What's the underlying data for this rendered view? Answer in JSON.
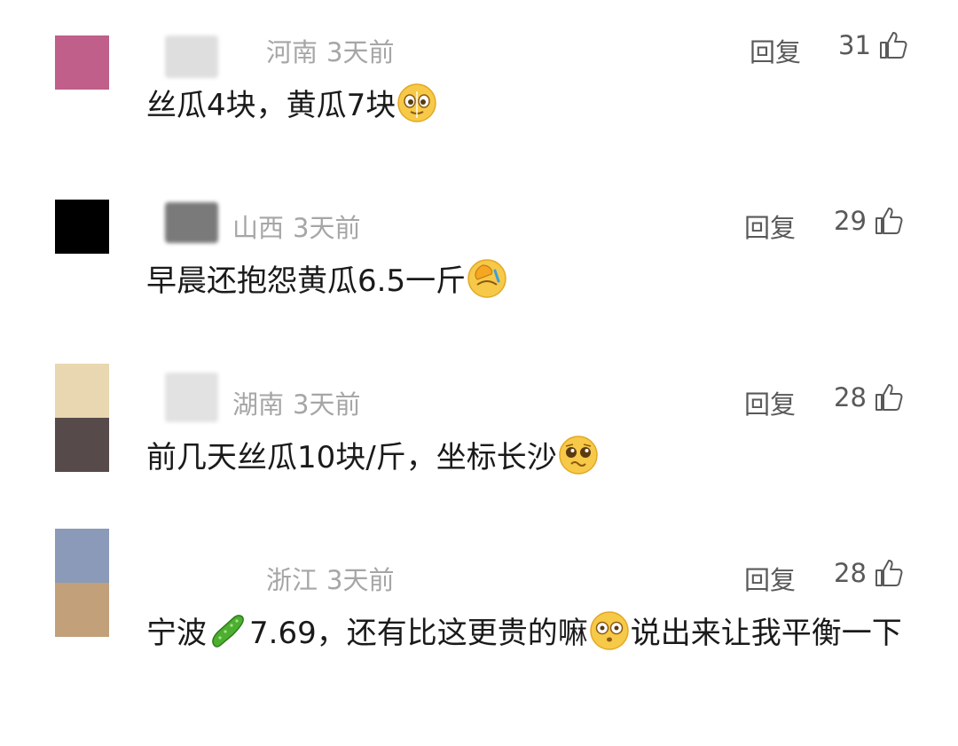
{
  "comments": [
    {
      "avatar_colors": [
        "#bf5f8a"
      ],
      "location": "河南",
      "time": "3天前",
      "reply_label": "回复",
      "likes": "31",
      "text_before": "丝瓜4块，黄瓜7块",
      "emoji": "smile-with-tear-emoji",
      "text_after": ""
    },
    {
      "avatar_colors": [
        "#000000"
      ],
      "location": "山西",
      "time": "3天前",
      "reply_label": "回复",
      "likes": "29",
      "text_before": "早晨还抱怨黄瓜6.5一斤",
      "emoji": "facepalm-emoji",
      "text_after": ""
    },
    {
      "avatar_colors": [
        "#e8d7b0",
        "#574a4a"
      ],
      "location": "湖南",
      "time": "3天前",
      "reply_label": "回复",
      "likes": "28",
      "text_before": "前几天丝瓜10块/斤，坐标长沙",
      "emoji": "pleading-face-emoji",
      "text_after": ""
    },
    {
      "avatar_colors": [
        "#8a9ab8",
        "#c2a07a"
      ],
      "location": "浙江",
      "time": "3天前",
      "reply_label": "回复",
      "likes": "28",
      "text_before": "宁波",
      "emoji_1": "cucumber-emoji",
      "text_middle": "7.69，还有比这更贵的嘛",
      "emoji_2": "surprised-face-emoji",
      "text_after": "说出来让我平衡一下"
    }
  ]
}
